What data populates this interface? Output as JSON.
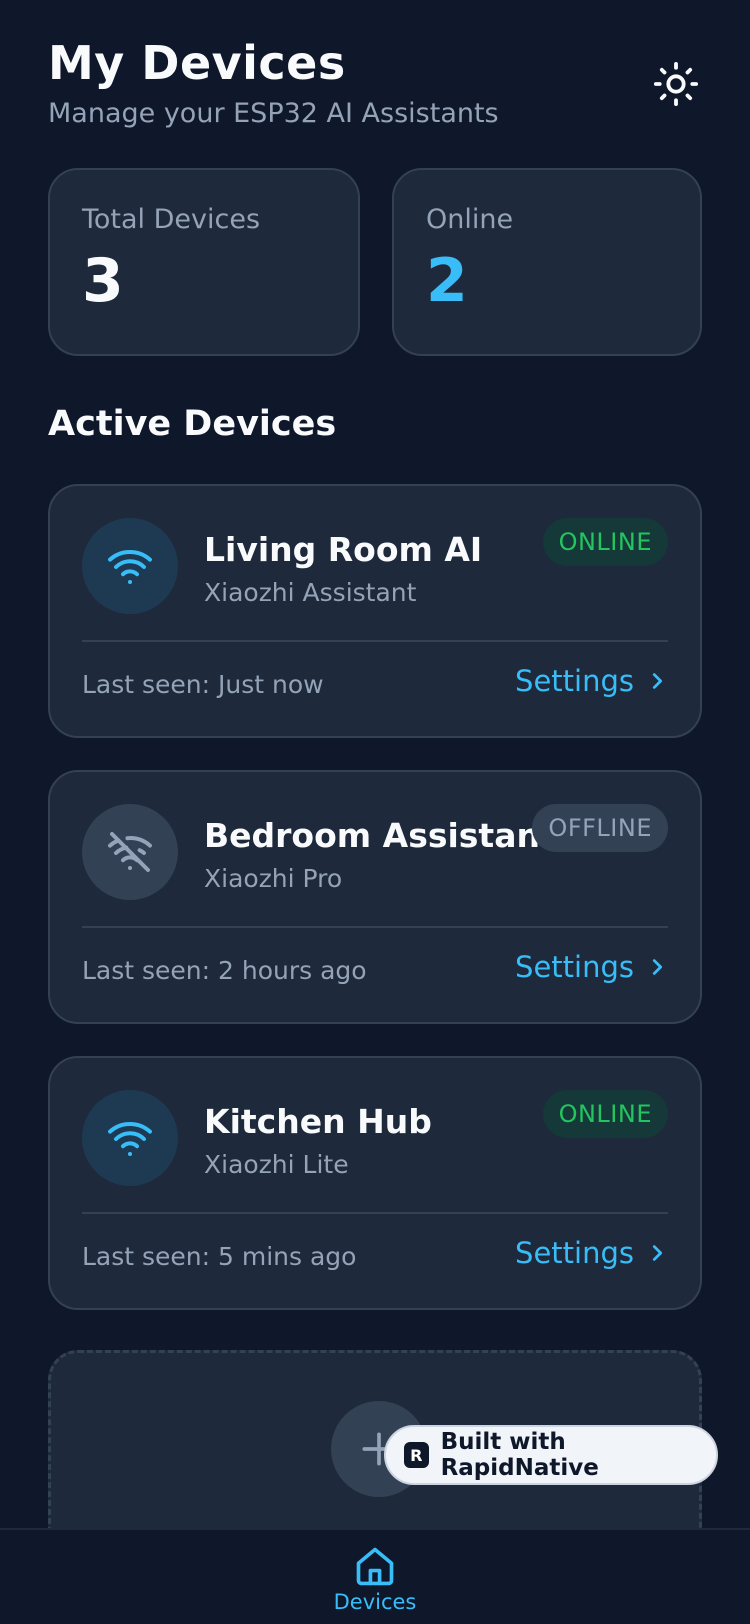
{
  "header": {
    "title": "My Devices",
    "subtitle": "Manage your ESP32 AI Assistants",
    "theme_icon": "sun-icon"
  },
  "stats": {
    "total_label": "Total Devices",
    "total_value": "3",
    "online_label": "Online",
    "online_value": "2"
  },
  "section": {
    "title": "Active Devices"
  },
  "devices": [
    {
      "name": "Living Room AI",
      "model": "Xiaozhi Assistant",
      "status": "ONLINE",
      "last_seen": "Last seen: Just now",
      "settings_label": "Settings",
      "icon": "wifi-icon"
    },
    {
      "name": "Bedroom Assistant",
      "model": "Xiaozhi Pro",
      "status": "OFFLINE",
      "last_seen": "Last seen: 2 hours ago",
      "settings_label": "Settings",
      "icon": "wifi-off-icon"
    },
    {
      "name": "Kitchen Hub",
      "model": "Xiaozhi Lite",
      "status": "ONLINE",
      "last_seen": "Last seen: 5 mins ago",
      "settings_label": "Settings",
      "icon": "wifi-icon"
    }
  ],
  "built_with": {
    "label": "Built with RapidNative",
    "logo_letter": "R"
  },
  "tabbar": {
    "items": [
      {
        "label": "Devices",
        "icon": "home-icon"
      }
    ]
  },
  "colors": {
    "accent": "#38bdf8",
    "online": "#22c55e",
    "background": "#0f172a",
    "card": "#1e293b"
  }
}
